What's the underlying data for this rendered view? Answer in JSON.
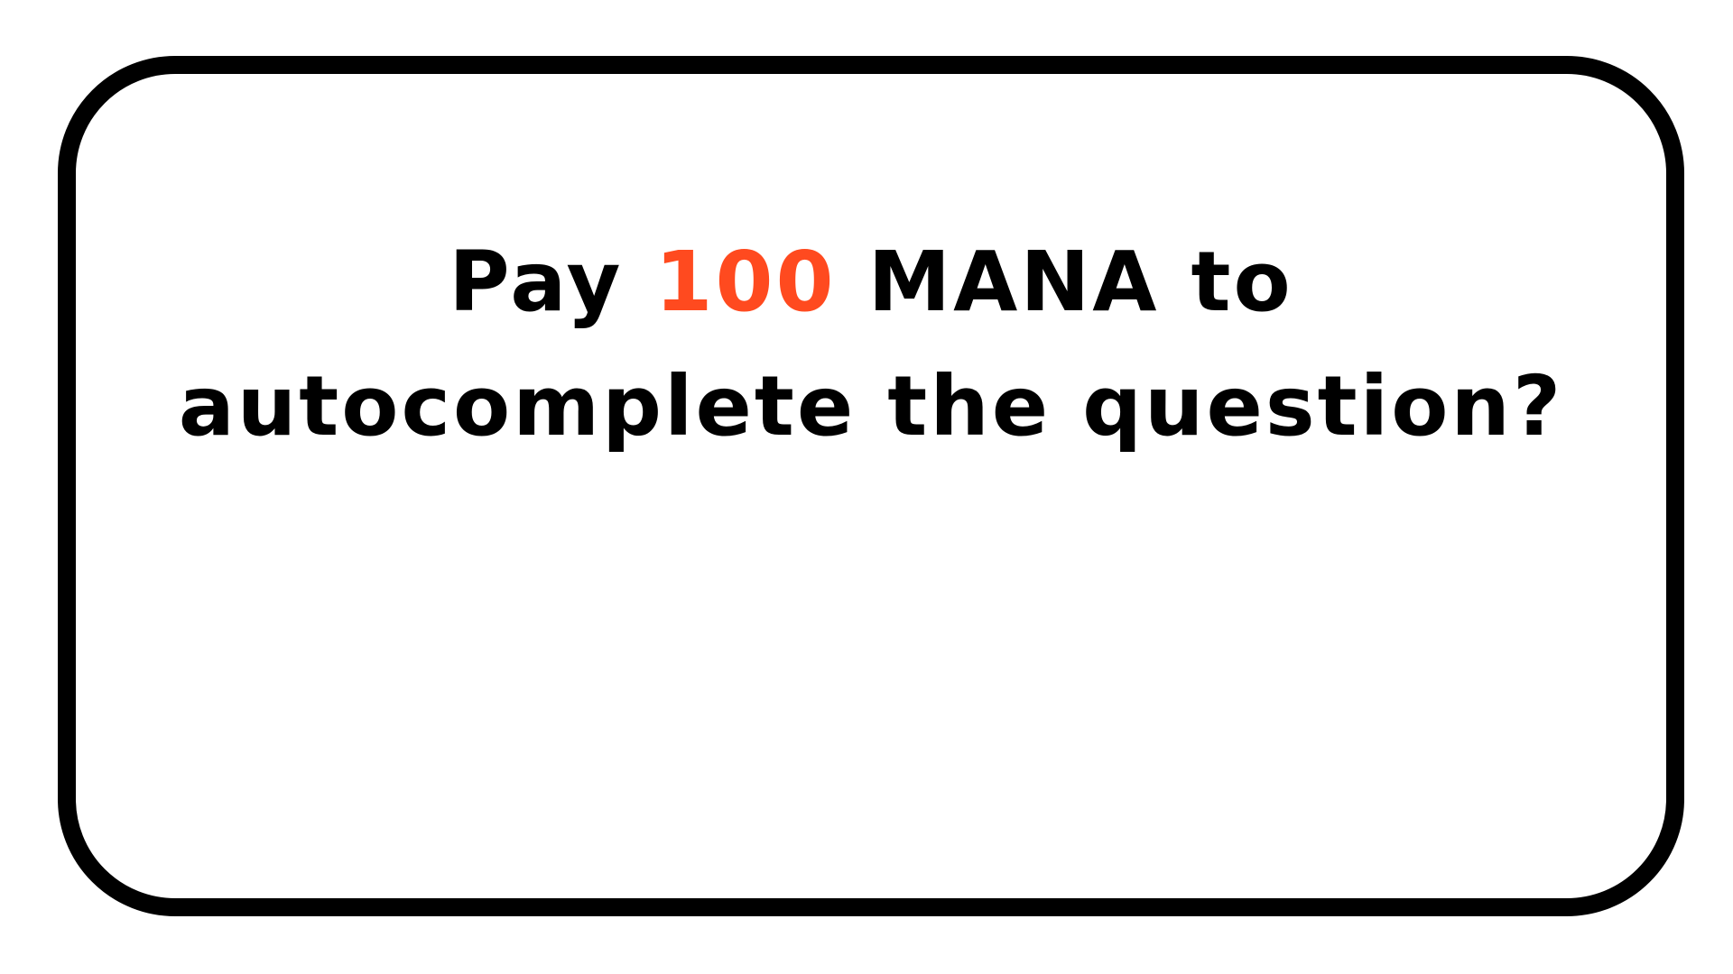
{
  "dialog": {
    "prompt_prefix": "Pay",
    "amount": "100",
    "prompt_suffix": "MANA to autocomplete the question?"
  },
  "colors": {
    "text": "#000000",
    "accent": "#ff4a1f",
    "border": "#000000",
    "background": "#ffffff"
  }
}
